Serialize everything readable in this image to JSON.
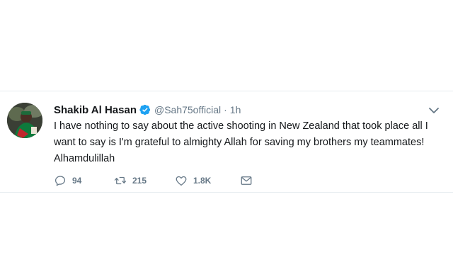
{
  "tweet": {
    "author": {
      "display_name": "Shakib Al Hasan",
      "handle": "@Sah75official",
      "verified": true
    },
    "separator": "·",
    "time": "1h",
    "text": "I have nothing to say about the active shooting in New Zealand that took place all I want to say is I'm grateful to almighty Allah for saving my brothers my teammates! Alhamdulillah",
    "actions": {
      "replies": "94",
      "retweets": "215",
      "likes": "1.8K"
    }
  },
  "colors": {
    "verified": "#1da1f2",
    "text": "#14171a",
    "muted": "#657786",
    "border": "#e6ecf0"
  },
  "icons": {
    "reply": "reply-icon",
    "retweet": "retweet-icon",
    "like": "like-icon",
    "dm": "direct-message-icon",
    "more": "chevron-down-icon",
    "verified": "verified-badge-icon"
  }
}
